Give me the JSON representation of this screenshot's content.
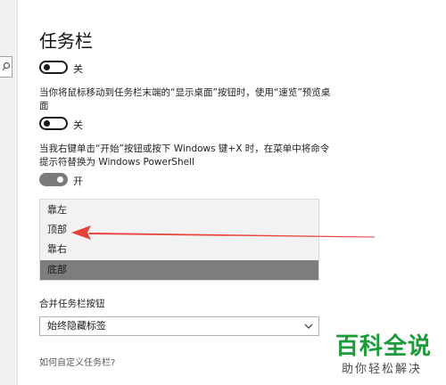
{
  "page": {
    "title": "任务栏"
  },
  "settings": [
    {
      "state": "off",
      "label": "关"
    },
    {
      "description": "当你将鼠标移动到任务栏末端的“显示桌面”按钮时，使用“速览”预览桌面",
      "state": "off",
      "label": "关"
    },
    {
      "description": "当我右键单击“开始”按钮或按下 Windows 键+X 时，在菜单中将命令提示符替换为 Windows PowerShell",
      "state": "on",
      "label": "开"
    }
  ],
  "position_dropdown": {
    "options": [
      "靠左",
      "顶部",
      "靠右",
      "底部"
    ],
    "selected": "底部"
  },
  "combine_buttons": {
    "label": "合并任务栏按钮",
    "value": "始终隐藏标签"
  },
  "help_link": "如何自定义任务栏?",
  "annotation": {
    "arrow_color": "#e8413a",
    "points_to": "顶部"
  },
  "watermark": {
    "title": "百科全说",
    "subtitle": "助你轻松解决",
    "color": "#1c9b3b"
  }
}
